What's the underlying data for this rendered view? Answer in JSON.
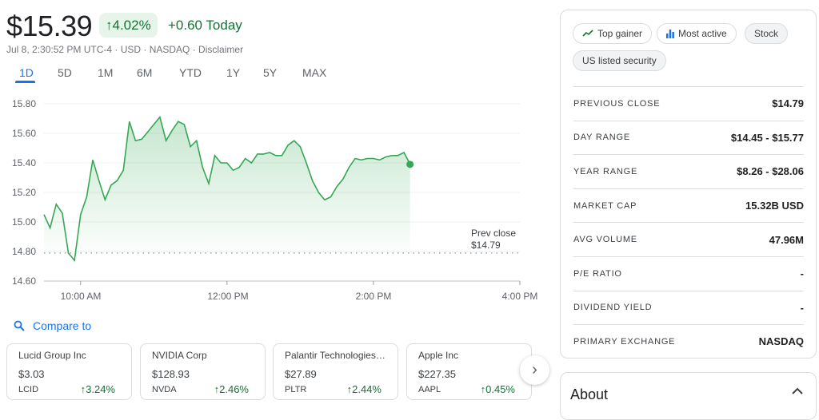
{
  "quote": {
    "price": "$15.39",
    "change_pct": "4.02%",
    "change_abs": "+0.60 Today",
    "meta": "Jul 8, 2:30:52 PM UTC-4 · USD · NASDAQ · Disclaimer",
    "up_color": "#137333",
    "accent": "#1a73e8"
  },
  "tabs": [
    "1D",
    "5D",
    "1M",
    "6M",
    "YTD",
    "1Y",
    "5Y",
    "MAX"
  ],
  "active_tab": "1D",
  "chart_data": {
    "type": "area",
    "y_ticks": [
      "15.80",
      "15.60",
      "15.40",
      "15.20",
      "15.00",
      "14.80",
      "14.60"
    ],
    "x_ticks": [
      "10:00 AM",
      "12:00 PM",
      "2:00 PM",
      "4:00 PM"
    ],
    "ylim": [
      14.6,
      15.8
    ],
    "xlim": [
      "09:30",
      "16:00"
    ],
    "prev_close": 14.79,
    "prev_close_label": "Prev close",
    "prev_close_value": "$14.79",
    "line_color": "#34a853",
    "x": [
      "09:30",
      "09:35",
      "09:40",
      "09:45",
      "09:50",
      "09:55",
      "10:00",
      "10:05",
      "10:10",
      "10:15",
      "10:20",
      "10:25",
      "10:30",
      "10:35",
      "10:40",
      "10:45",
      "10:50",
      "10:55",
      "11:00",
      "11:05",
      "11:10",
      "11:15",
      "11:20",
      "11:25",
      "11:30",
      "11:35",
      "11:40",
      "11:45",
      "11:50",
      "11:55",
      "12:00",
      "12:05",
      "12:10",
      "12:15",
      "12:20",
      "12:25",
      "12:30",
      "12:35",
      "12:40",
      "12:45",
      "12:50",
      "12:55",
      "13:00",
      "13:05",
      "13:10",
      "13:15",
      "13:20",
      "13:25",
      "13:30",
      "13:35",
      "13:40",
      "13:45",
      "13:50",
      "13:55",
      "14:00",
      "14:05",
      "14:10",
      "14:15",
      "14:20",
      "14:25",
      "14:30"
    ],
    "values": [
      15.05,
      14.96,
      15.12,
      15.06,
      14.79,
      14.74,
      15.05,
      15.17,
      15.42,
      15.28,
      15.15,
      15.25,
      15.28,
      15.35,
      15.68,
      15.55,
      15.56,
      15.61,
      15.66,
      15.71,
      15.55,
      15.62,
      15.68,
      15.66,
      15.51,
      15.55,
      15.37,
      15.26,
      15.45,
      15.4,
      15.4,
      15.35,
      15.37,
      15.43,
      15.4,
      15.46,
      15.46,
      15.47,
      15.45,
      15.45,
      15.52,
      15.55,
      15.51,
      15.4,
      15.28,
      15.2,
      15.15,
      15.17,
      15.24,
      15.29,
      15.37,
      15.43,
      15.42,
      15.43,
      15.43,
      15.42,
      15.44,
      15.45,
      15.45,
      15.47,
      15.39
    ]
  },
  "compare": {
    "label": "Compare to",
    "cards": [
      {
        "name": "Lucid Group Inc",
        "price": "$3.03",
        "ticker": "LCID",
        "change": "3.24%"
      },
      {
        "name": "NVIDIA Corp",
        "price": "$128.93",
        "ticker": "NVDA",
        "change": "2.46%"
      },
      {
        "name": "Palantir Technologies I...",
        "price": "$27.89",
        "ticker": "PLTR",
        "change": "2.44%"
      },
      {
        "name": "Apple Inc",
        "price": "$227.35",
        "ticker": "AAPL",
        "change": "0.45%"
      }
    ]
  },
  "panel": {
    "chips": [
      "Top gainer",
      "Most active",
      "Stock",
      "US listed security"
    ],
    "rows": [
      {
        "label": "PREVIOUS CLOSE",
        "value": "$14.79"
      },
      {
        "label": "DAY RANGE",
        "value": "$14.45 - $15.77"
      },
      {
        "label": "YEAR RANGE",
        "value": "$8.26 - $28.06"
      },
      {
        "label": "MARKET CAP",
        "value": "15.32B USD"
      },
      {
        "label": "AVG VOLUME",
        "value": "47.96M"
      },
      {
        "label": "P/E RATIO",
        "value": "-"
      },
      {
        "label": "DIVIDEND YIELD",
        "value": "-"
      },
      {
        "label": "PRIMARY EXCHANGE",
        "value": "NASDAQ"
      }
    ]
  },
  "about": {
    "title": "About"
  }
}
